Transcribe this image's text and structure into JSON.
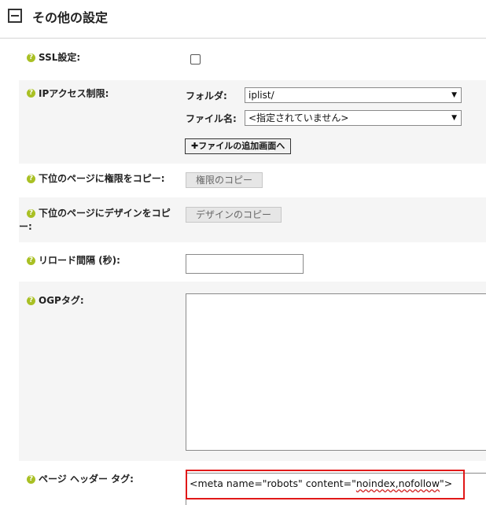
{
  "section": {
    "title": "その他の設定",
    "collapse_symbol": "minus-box-icon"
  },
  "help_icon": "?",
  "rows": {
    "ssl": {
      "label": "SSL設定:",
      "checked": false
    },
    "ip_access": {
      "label": "IPアクセス制限:",
      "folder_label": "フォルダ:",
      "folder_value": "iplist/",
      "file_label": "ファイル名:",
      "file_value": "<指定されていません>",
      "add_file_button": "✚ファイルの追加画面へ"
    },
    "copy_permission": {
      "label": "下位のページに権限をコピー:",
      "button": "権限のコピー"
    },
    "copy_design": {
      "label_line1": "下位のページにデザインをコピ",
      "label_line2": "ー:",
      "button": "デザインのコピー"
    },
    "reload_interval": {
      "label": "リロード間隔 (秒):",
      "value": ""
    },
    "ogp_tag": {
      "label": "OGPタグ:",
      "value": ""
    },
    "page_header_tag": {
      "label": "ページ ヘッダー タグ:",
      "value_prefix": "<meta name=\"robots\" content=\"",
      "value_squiggle": "noindex,nofollow",
      "value_suffix": "\">"
    }
  },
  "colors": {
    "help_icon": "#a9c024",
    "row_shade": "#f5f5f5",
    "highlight": "#e11818"
  }
}
